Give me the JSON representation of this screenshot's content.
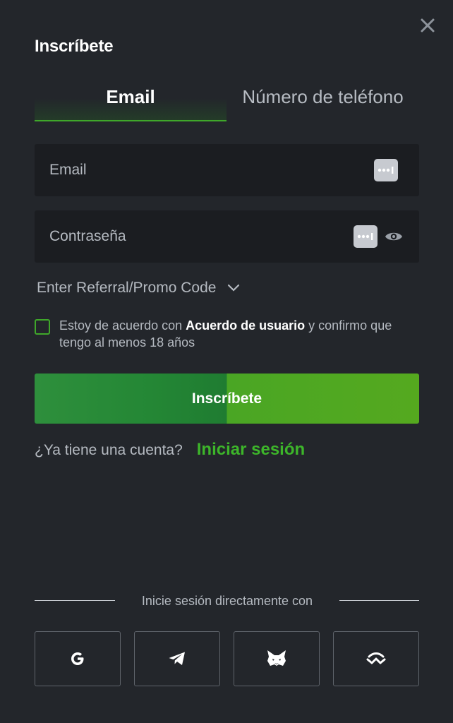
{
  "dialog": {
    "title": "Inscríbete",
    "close_icon": "close-icon"
  },
  "tabs": [
    {
      "label": "Email",
      "active": true
    },
    {
      "label": "Número de teléfono",
      "active": false
    }
  ],
  "form": {
    "email_placeholder": "Email",
    "password_placeholder": "Contraseña",
    "password_manager_icon": "password-manager-icon",
    "show_password_icon": "eye-icon",
    "promo_label": "Enter Referral/Promo Code",
    "promo_icon": "chevron-down-icon"
  },
  "agreement": {
    "checked": false,
    "text_before": "Estoy de acuerdo con ",
    "link_text": "Acuerdo de usuario",
    "text_after": " y confirmo que tengo al menos 18 años"
  },
  "submit_label": "Inscríbete",
  "login": {
    "question": "¿Ya tiene una cuenta?",
    "link": "Iniciar sesión"
  },
  "social": {
    "divider_text": "Inicie sesión directamente con",
    "providers": [
      {
        "icon": "google-icon"
      },
      {
        "icon": "telegram-icon"
      },
      {
        "icon": "metamask-icon"
      },
      {
        "icon": "walletconnect-icon"
      }
    ]
  },
  "colors": {
    "background": "#23262b",
    "field_bg": "#1b1d21",
    "accent_green": "#3fa72a",
    "link_green": "#3db52a",
    "muted_text": "#b5bac1"
  }
}
